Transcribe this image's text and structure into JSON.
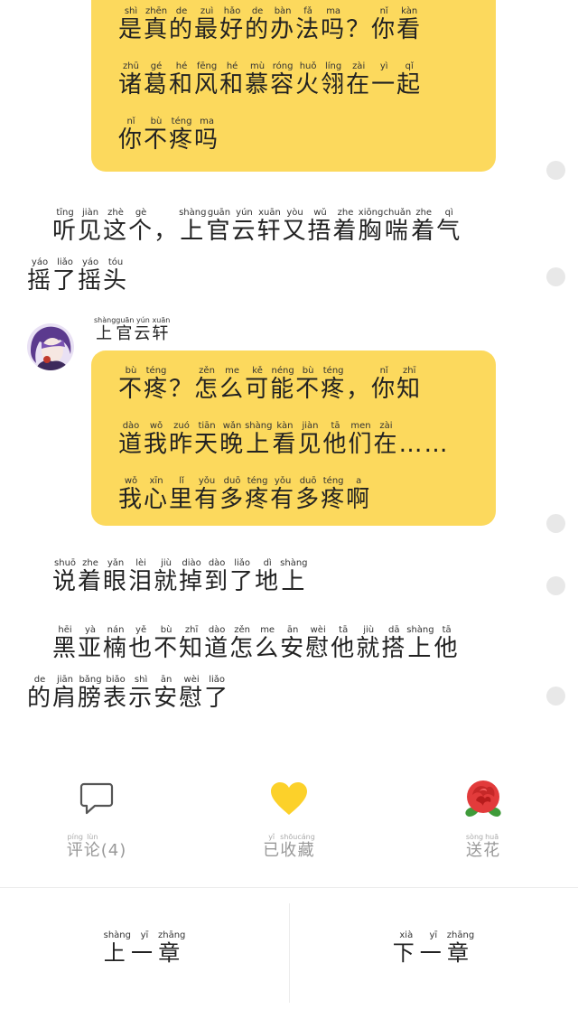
{
  "bubble1": {
    "lines": [
      [
        [
          "是",
          "shì"
        ],
        [
          "真",
          "zhēn"
        ],
        [
          "的",
          "de"
        ],
        [
          "最",
          "zuì"
        ],
        [
          "好",
          "hǎo"
        ],
        [
          "的",
          "de"
        ],
        [
          "办",
          "bàn"
        ],
        [
          "法",
          "fǎ"
        ],
        [
          "吗",
          "ma"
        ],
        [
          "？",
          ""
        ],
        [
          "你",
          "nǐ"
        ],
        [
          "看",
          "kàn"
        ]
      ],
      [
        [
          "诸",
          "zhū"
        ],
        [
          "葛",
          "gé"
        ],
        [
          "和",
          "hé"
        ],
        [
          "风",
          "fēng"
        ],
        [
          "和",
          "hé"
        ],
        [
          "慕",
          "mù"
        ],
        [
          "容",
          "róng"
        ],
        [
          "火",
          "huǒ"
        ],
        [
          "翎",
          "líng"
        ],
        [
          "在",
          "zài"
        ],
        [
          "一",
          "yì"
        ],
        [
          "起",
          "qǐ"
        ]
      ],
      [
        [
          "你",
          "nǐ"
        ],
        [
          "不",
          "bù"
        ],
        [
          "疼",
          "téng"
        ],
        [
          "吗",
          "ma"
        ]
      ]
    ]
  },
  "narration1": {
    "lines": [
      [
        [
          "　",
          ""
        ],
        [
          "听",
          "tīng"
        ],
        [
          "见",
          "jiàn"
        ],
        [
          "这",
          "zhè"
        ],
        [
          "个",
          "gè"
        ],
        [
          "，",
          ""
        ],
        [
          "上",
          "shàng"
        ],
        [
          "官",
          "guān"
        ],
        [
          "云",
          "yún"
        ],
        [
          "轩",
          "xuān"
        ],
        [
          "又",
          "yòu"
        ],
        [
          "捂",
          "wǔ"
        ],
        [
          "着",
          "zhe"
        ],
        [
          "胸",
          "xiōng"
        ],
        [
          "喘",
          "chuǎn"
        ],
        [
          "着",
          "zhe"
        ],
        [
          "气",
          "qì"
        ]
      ],
      [
        [
          "摇",
          "yáo"
        ],
        [
          "了",
          "liǎo"
        ],
        [
          "摇",
          "yáo"
        ],
        [
          "头",
          "tóu"
        ]
      ]
    ]
  },
  "speaker": {
    "name": [
      [
        "上",
        "shàng"
      ],
      [
        "官",
        "guān"
      ],
      [
        "云",
        "yún"
      ],
      [
        "轩",
        "xuān"
      ]
    ]
  },
  "bubble2": {
    "lines": [
      [
        [
          "不",
          "bù"
        ],
        [
          "疼",
          "téng"
        ],
        [
          "？",
          ""
        ],
        [
          "怎",
          "zěn"
        ],
        [
          "么",
          "me"
        ],
        [
          "可",
          "kě"
        ],
        [
          "能",
          "néng"
        ],
        [
          "不",
          "bù"
        ],
        [
          "疼",
          "téng"
        ],
        [
          "，",
          ""
        ],
        [
          "你",
          "nǐ"
        ],
        [
          "知",
          "zhī"
        ]
      ],
      [
        [
          "道",
          "dào"
        ],
        [
          "我",
          "wǒ"
        ],
        [
          "昨",
          "zuó"
        ],
        [
          "天",
          "tiān"
        ],
        [
          "晚",
          "wǎn"
        ],
        [
          "上",
          "shàng"
        ],
        [
          "看",
          "kàn"
        ],
        [
          "见",
          "jiàn"
        ],
        [
          "他",
          "tā"
        ],
        [
          "们",
          "men"
        ],
        [
          "在",
          "zài"
        ],
        [
          "……",
          ""
        ]
      ],
      [
        [
          "我",
          "wǒ"
        ],
        [
          "心",
          "xīn"
        ],
        [
          "里",
          "lǐ"
        ],
        [
          "有",
          "yǒu"
        ],
        [
          "多",
          "duō"
        ],
        [
          "疼",
          "téng"
        ],
        [
          "有",
          "yǒu"
        ],
        [
          "多",
          "duō"
        ],
        [
          "疼",
          "téng"
        ],
        [
          "啊",
          "a"
        ]
      ]
    ]
  },
  "narration2": {
    "lines": [
      [
        [
          "　",
          ""
        ],
        [
          "说",
          "shuō"
        ],
        [
          "着",
          "zhe"
        ],
        [
          "眼",
          "yǎn"
        ],
        [
          "泪",
          "lèi"
        ],
        [
          "就",
          "jiù"
        ],
        [
          "掉",
          "diào"
        ],
        [
          "到",
          "dào"
        ],
        [
          "了",
          "liǎo"
        ],
        [
          "地",
          "dì"
        ],
        [
          "上",
          "shàng"
        ]
      ]
    ]
  },
  "narration3": {
    "lines": [
      [
        [
          "　",
          ""
        ],
        [
          "黑",
          "hēi"
        ],
        [
          "亚",
          "yà"
        ],
        [
          "楠",
          "nán"
        ],
        [
          "也",
          "yě"
        ],
        [
          "不",
          "bù"
        ],
        [
          "知",
          "zhī"
        ],
        [
          "道",
          "dào"
        ],
        [
          "怎",
          "zěn"
        ],
        [
          "么",
          "me"
        ],
        [
          "安",
          "ān"
        ],
        [
          "慰",
          "wèi"
        ],
        [
          "他",
          "tā"
        ],
        [
          "就",
          "jiù"
        ],
        [
          "搭",
          "dā"
        ],
        [
          "上",
          "shàng"
        ],
        [
          "他",
          "tā"
        ]
      ],
      [
        [
          "的",
          "de"
        ],
        [
          "肩",
          "jiān"
        ],
        [
          "膀",
          "bǎng"
        ],
        [
          "表",
          "biǎo"
        ],
        [
          "示",
          "shì"
        ],
        [
          "安",
          "ān"
        ],
        [
          "慰",
          "wèi"
        ],
        [
          "了",
          "liǎo"
        ]
      ]
    ]
  },
  "actions": {
    "comment": {
      "label": [
        [
          "评",
          "píng"
        ],
        [
          "论",
          "lùn"
        ],
        [
          "(4)",
          ""
        ]
      ],
      "icon": "speech-bubble-icon"
    },
    "favorite": {
      "label": [
        [
          "已",
          "yǐ"
        ],
        [
          "收",
          "shōu"
        ],
        [
          "藏",
          "cáng"
        ]
      ],
      "icon": "heart-icon",
      "color": "#fcd12a"
    },
    "flower": {
      "label": [
        [
          "送",
          "sòng"
        ],
        [
          "花",
          "huā"
        ]
      ],
      "icon": "rose-icon",
      "color": "#e23b3b"
    }
  },
  "nav": {
    "prev": [
      [
        "上",
        "shàng"
      ],
      [
        "一",
        "yī"
      ],
      [
        "章",
        "zhāng"
      ]
    ],
    "next": [
      [
        "下",
        "xià"
      ],
      [
        "一",
        "yī"
      ],
      [
        "章",
        "zhāng"
      ]
    ]
  },
  "colors": {
    "bubble": "#fcd95d",
    "dot": "#e8e8e8"
  }
}
